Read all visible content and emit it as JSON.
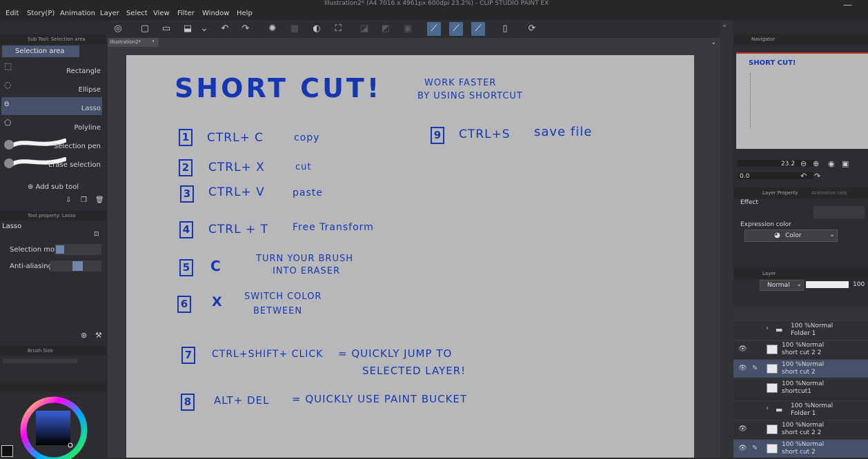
{
  "menu": [
    "Edit",
    "Story(P)",
    "Animation",
    "Layer",
    "Select",
    "View",
    "Filter",
    "Window",
    "Help"
  ],
  "window_title": "Illustration2* (A4 7016 x 4961px 600dpi 23.2%) - CLIP STUDIO PAINT EX",
  "document_tab": "Illustration2*",
  "sub_tool_panel": {
    "header": "Sub Tool: Selection area",
    "group": "Selection area",
    "items": [
      "Rectangle",
      "Ellipse",
      "Lasso",
      "Polyline",
      "Selection pen",
      "Erase selection"
    ],
    "selected_index": 2,
    "add_label": "Add sub tool"
  },
  "tool_property": {
    "header": "Tool property: Lasso",
    "title": "Lasso",
    "selection_mode_label": "Selection mode",
    "anti_aliasing_label": "Anti-aliasing"
  },
  "brush_size": {
    "header": "Brush Size"
  },
  "navigator": {
    "header": "Navigator",
    "zoom_value": "23.2",
    "rotation_value": "0.0"
  },
  "layer_property": {
    "tabs": [
      "Layer Property",
      "Animation cels"
    ],
    "effect_label": "Effect",
    "expression_color_label": "Expression color",
    "expression_color_value": "Color"
  },
  "layer_panel": {
    "header": "Layer",
    "blend_mode": "Normal",
    "opacity": "100",
    "layers": [
      {
        "type": "folder",
        "line1": "100 %Normal",
        "line2": "Folder 1",
        "visible": false,
        "selected": false
      },
      {
        "type": "layer",
        "line1": "100 %Normal",
        "line2": "short cut 2 2",
        "visible": true,
        "selected": false
      },
      {
        "type": "layer",
        "line1": "100 %Normal",
        "line2": "short cut 2",
        "visible": true,
        "selected": true
      },
      {
        "type": "layer",
        "line1": "100 %Normal",
        "line2": "shortcut1",
        "visible": false,
        "selected": false
      },
      {
        "type": "folder",
        "line1": "100 %Normal",
        "line2": "Folder 1",
        "visible": false,
        "selected": false
      },
      {
        "type": "layer",
        "line1": "100 %Normal",
        "line2": "short cut 2 2",
        "visible": true,
        "selected": false
      },
      {
        "type": "layer",
        "line1": "100 %Normal",
        "line2": "short cut 2",
        "visible": true,
        "selected": true
      }
    ]
  },
  "canvas_note": {
    "title": "SHORT CUT!",
    "subtitle_1": "WORK FASTER",
    "subtitle_2": "BY USING SHORTCUT",
    "items": [
      {
        "num": "1",
        "keys": "CTRL+ C",
        "desc": "copy"
      },
      {
        "num": "2",
        "keys": "CTRL+ X",
        "desc": "cut"
      },
      {
        "num": "3",
        "keys": "CTRL+ V",
        "desc": "paste"
      },
      {
        "num": "4",
        "keys": "CTRL + T",
        "desc": "Free Transform"
      },
      {
        "num": "5",
        "keys": "C",
        "desc": "TURN YOUR BRUSH",
        "desc2": "INTO ERASER"
      },
      {
        "num": "6",
        "keys": "X",
        "desc": "SWITCH COLOR",
        "desc2": "BETWEEN"
      },
      {
        "num": "7",
        "keys": "CTRL+SHIFT+ CLICK",
        "desc": "= QUICKLY JUMP TO",
        "desc2": "SELECTED LAYER!"
      },
      {
        "num": "8",
        "keys": "ALT+ DEL",
        "desc": "= QUICKLY USE PAINT BUCKET"
      },
      {
        "num": "9",
        "keys": "CTRL+S",
        "desc": "save file"
      }
    ]
  },
  "colors": {
    "ink": "#1538b0",
    "paper": "#b8b8ba",
    "selection": "#45506a",
    "accent_toolbar": "#4d6b8f"
  }
}
